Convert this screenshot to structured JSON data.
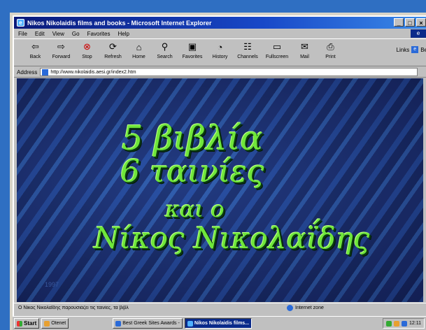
{
  "window": {
    "title": "Nikos Nikolaidis films and books - Microsoft Internet Explorer",
    "controls": [
      "_",
      "□",
      "×"
    ]
  },
  "menu": [
    "File",
    "Edit",
    "View",
    "Go",
    "Favorites",
    "Help"
  ],
  "toolbar": [
    {
      "label": "Back",
      "icon": "back-arrow-icon"
    },
    {
      "label": "Forward",
      "icon": "forward-arrow-icon"
    },
    {
      "label": "Stop",
      "icon": "stop-icon"
    },
    {
      "label": "Refresh",
      "icon": "refresh-icon"
    },
    {
      "label": "Home",
      "icon": "home-icon"
    },
    {
      "label": "Search",
      "icon": "search-icon"
    },
    {
      "label": "Favorites",
      "icon": "favorites-icon"
    },
    {
      "label": "History",
      "icon": "history-icon"
    },
    {
      "label": "Channels",
      "icon": "channels-icon"
    },
    {
      "label": "Fullscreen",
      "icon": "fullscreen-icon"
    },
    {
      "label": "Mail",
      "icon": "mail-icon"
    },
    {
      "label": "Print",
      "icon": "print-icon"
    }
  ],
  "links": {
    "label": "Links",
    "item": "Be"
  },
  "address": {
    "label": "Address",
    "url": "http://www.nikolaidis.aesi.gr/index2.htm"
  },
  "page": {
    "line1": "5 βιβλία",
    "line2": "6 ταινίες",
    "line3": "και ο",
    "line4": "Νίκος Νικολαΐδης",
    "footer": "1997"
  },
  "status": {
    "message": "Ο Νίκος Νικολαΐδης παρουσιάζει τις ταινίες, τα βιβλ",
    "zone": "Internet zone"
  },
  "taskbar": {
    "start": "Start",
    "tasks": [
      "Otenet",
      "Best Greek Sites Awards -",
      "Nikos Nikolaidis films..."
    ],
    "clock": "12:11"
  }
}
